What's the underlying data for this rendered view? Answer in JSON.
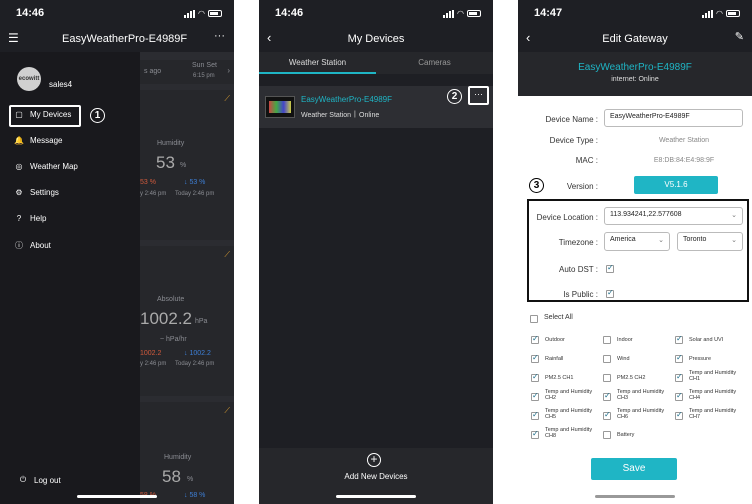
{
  "p1": {
    "time": "14:46",
    "title": "EasyWeatherPro-E4989F",
    "user": "sales4",
    "avatar": "ecowitt",
    "menu": [
      {
        "icon": "▢",
        "label": "My Devices"
      },
      {
        "icon": "🔔",
        "label": "Message"
      },
      {
        "icon": "◎",
        "label": "Weather Map"
      },
      {
        "icon": "⚙",
        "label": "Settings"
      },
      {
        "icon": "?",
        "label": "Help"
      },
      {
        "icon": "ⓘ",
        "label": "About"
      }
    ],
    "logout": "Log out",
    "step": "1",
    "bg": {
      "ago": "s ago",
      "sunset": "Sun Set",
      "sunset_time": "6:15 pm",
      "humidity": "Humidity",
      "hum_val": "53",
      "pct": "%",
      "lo": "53 %",
      "hi": "↓ 53 %",
      "t1": "y 2:46 pm",
      "t2": "Today 2:46 pm",
      "absolute": "Absolute",
      "pressure": "1002.2",
      "hpa": "hPa",
      "trend": "~ hPa/hr",
      "p_lo": "1002.2",
      "p_hi": "↓ 1002.2",
      "t3": "y 2:46 pm",
      "t4": "Today 2:46 pm",
      "humidity2": "Humidity",
      "hum2": "58",
      "pct2": "%",
      "lo2": "58 %",
      "hi2": "↓ 58 %"
    }
  },
  "p2": {
    "time": "14:46",
    "title": "My Devices",
    "tabs": [
      "Weather Station",
      "Cameras"
    ],
    "device": "EasyWeatherPro-E4989F",
    "type": "Weather Station",
    "status": "Online",
    "more": "···",
    "add": "Add New Devices",
    "step": "2"
  },
  "p3": {
    "time": "14:47",
    "title": "Edit Gateway",
    "name": "EasyWeatherPro-E4989F",
    "internet": "internet: Online",
    "labels": {
      "name": "Device Name :",
      "type": "Device Type :",
      "mac": "MAC :",
      "version": "Version :",
      "location": "Device Location :",
      "timezone": "Timezone :",
      "dst": "Auto DST :",
      "public": "Is Public :"
    },
    "device_name": "EasyWeatherPro-E4989F",
    "device_type": "Weather Station",
    "mac": "E8:DB:84:E4:98:9F",
    "version": "V5.1.6",
    "location": "113.934241,22.577608",
    "tz1": "America",
    "tz2": "Toronto",
    "step": "3",
    "select_all": "Select All",
    "options": [
      "Outdoor",
      "Indoor",
      "Solar and UVI",
      "Rainfall",
      "Wind",
      "Pressure",
      "PM2.5 CH1",
      "PM2.5 CH2",
      "Temp and Humidity CH1",
      "Temp and Humidity CH2",
      "Temp and Humidity CH3",
      "Temp and Humidity CH4",
      "Temp and Humidity CH5",
      "Temp and Humidity CH6",
      "Temp and Humidity CH7",
      "Temp and Humidity CH8",
      "Battery"
    ],
    "save": "Save"
  },
  "colors": {
    "accent": "#1fb5c5",
    "dark": "#1e1f24",
    "blue": "#3d7fd6",
    "red": "#d05a3c"
  }
}
